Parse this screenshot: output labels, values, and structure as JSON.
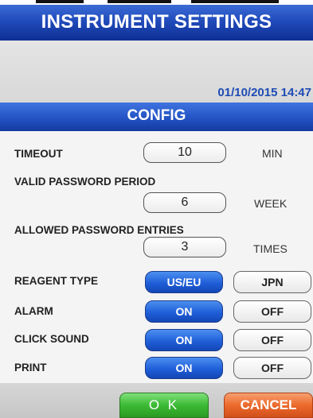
{
  "header": {
    "title": "INSTRUMENT SETTINGS"
  },
  "status": {
    "datetime": "01/10/2015 14:47"
  },
  "section": {
    "title": "CONFIG"
  },
  "timeout": {
    "label": "TIMEOUT",
    "value": "10",
    "unit": "MIN"
  },
  "password_period": {
    "label": "VALID PASSWORD PERIOD",
    "value": "6",
    "unit": "WEEK"
  },
  "password_entries": {
    "label": "ALLOWED PASSWORD ENTRIES",
    "value": "3",
    "unit": "TIMES"
  },
  "reagent_type": {
    "label": "REAGENT TYPE",
    "option_a": "US/EU",
    "option_b": "JPN",
    "selected": "US/EU"
  },
  "alarm": {
    "label": "ALARM",
    "on": "ON",
    "off": "OFF",
    "selected": "ON"
  },
  "click_sound": {
    "label": "CLICK SOUND",
    "on": "ON",
    "off": "OFF",
    "selected": "ON"
  },
  "print": {
    "label": "PRINT",
    "on": "ON",
    "off": "OFF",
    "selected": "ON"
  },
  "footer": {
    "ok": "O K",
    "cancel": "CANCEL"
  },
  "colors": {
    "header_blue": "#1f48b8",
    "selected_blue": "#1f5fd8",
    "ok_green": "#3cba34",
    "cancel_orange": "#ec6a2c",
    "date_text": "#1e4bb5"
  }
}
